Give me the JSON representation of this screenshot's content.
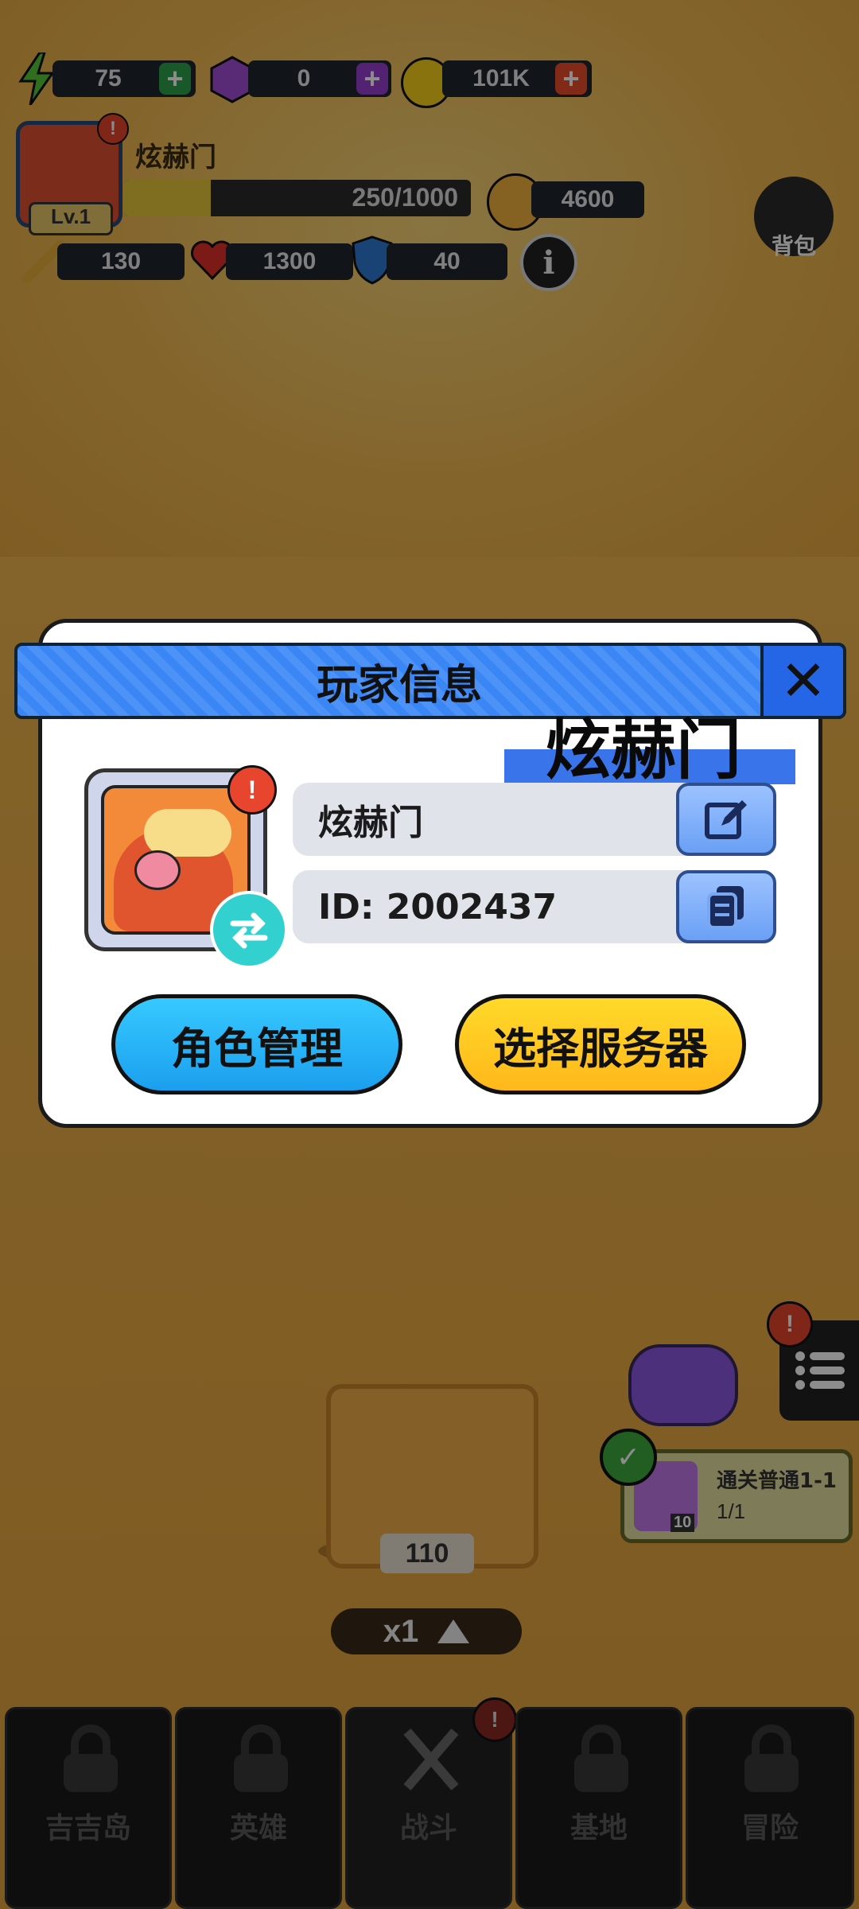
{
  "hud": {
    "energy": "75",
    "gems": "0",
    "coins": "101K",
    "player_name": "炫赫门",
    "level": "Lv.1",
    "xp": "250/1000",
    "xp_progress": 0.25,
    "power": "4600",
    "attack": "130",
    "health": "1300",
    "defense": "40",
    "backpack_label": "背包"
  },
  "modal": {
    "title": "玩家信息",
    "overlay_name": "炫赫门",
    "name_value": "炫赫门",
    "id_value": "ID: 2002437",
    "role_button": "角色管理",
    "server_button": "选择服务器"
  },
  "scene": {
    "chest_count": "110",
    "speed": "x1",
    "quest_title": "通关普通1-1",
    "quest_progress": "1/1",
    "quest_reward_count": "10"
  },
  "tabs": [
    {
      "label": "吉吉岛"
    },
    {
      "label": "英雄"
    },
    {
      "label": "战斗"
    },
    {
      "label": "基地"
    },
    {
      "label": "冒险"
    }
  ],
  "colors": {
    "accent_blue": "#3a86f5",
    "accent_yellow": "#ffcc1a",
    "accent_cyan": "#1ab6f5"
  }
}
